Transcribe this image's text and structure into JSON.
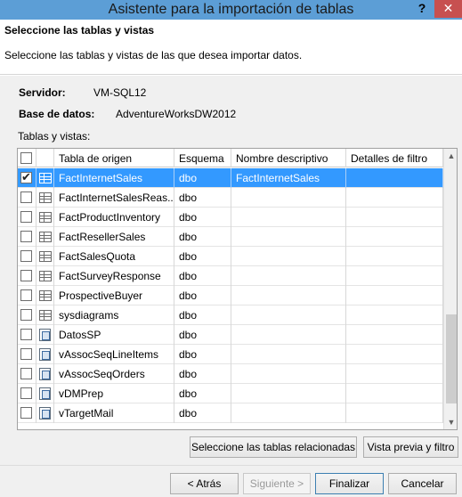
{
  "window": {
    "title": "Asistente para la importación de tablas",
    "help_label": "?",
    "close_label": "✕"
  },
  "header": {
    "heading": "Seleccione las tablas y vistas",
    "description": "Seleccione las tablas y vistas de las que desea importar datos."
  },
  "connection": {
    "server_label": "Servidor:",
    "server_value": "VM-SQL12",
    "database_label": "Base de datos:",
    "database_value": "AdventureWorksDW2012",
    "list_label": "Tablas y vistas:"
  },
  "grid": {
    "columns": [
      "Tabla de origen",
      "Esquema",
      "Nombre descriptivo",
      "Detalles de filtro"
    ],
    "rows": [
      {
        "name": "FactInternetSales",
        "schema": "dbo",
        "friendly": "FactInternetSales",
        "filter": "",
        "checked": true,
        "selected": true,
        "icon": "table-icon"
      },
      {
        "name": "FactInternetSalesReas...",
        "schema": "dbo",
        "friendly": "",
        "filter": "",
        "checked": false,
        "selected": false,
        "icon": "table-icon"
      },
      {
        "name": "FactProductInventory",
        "schema": "dbo",
        "friendly": "",
        "filter": "",
        "checked": false,
        "selected": false,
        "icon": "table-icon"
      },
      {
        "name": "FactResellerSales",
        "schema": "dbo",
        "friendly": "",
        "filter": "",
        "checked": false,
        "selected": false,
        "icon": "table-icon"
      },
      {
        "name": "FactSalesQuota",
        "schema": "dbo",
        "friendly": "",
        "filter": "",
        "checked": false,
        "selected": false,
        "icon": "table-icon"
      },
      {
        "name": "FactSurveyResponse",
        "schema": "dbo",
        "friendly": "",
        "filter": "",
        "checked": false,
        "selected": false,
        "icon": "table-icon"
      },
      {
        "name": "ProspectiveBuyer",
        "schema": "dbo",
        "friendly": "",
        "filter": "",
        "checked": false,
        "selected": false,
        "icon": "table-icon"
      },
      {
        "name": "sysdiagrams",
        "schema": "dbo",
        "friendly": "",
        "filter": "",
        "checked": false,
        "selected": false,
        "icon": "table-icon"
      },
      {
        "name": "DatosSP",
        "schema": "dbo",
        "friendly": "",
        "filter": "",
        "checked": false,
        "selected": false,
        "icon": "view-icon"
      },
      {
        "name": "vAssocSeqLineItems",
        "schema": "dbo",
        "friendly": "",
        "filter": "",
        "checked": false,
        "selected": false,
        "icon": "view-icon"
      },
      {
        "name": "vAssocSeqOrders",
        "schema": "dbo",
        "friendly": "",
        "filter": "",
        "checked": false,
        "selected": false,
        "icon": "view-icon"
      },
      {
        "name": "vDMPrep",
        "schema": "dbo",
        "friendly": "",
        "filter": "",
        "checked": false,
        "selected": false,
        "icon": "view-icon"
      },
      {
        "name": "vTargetMail",
        "schema": "dbo",
        "friendly": "",
        "filter": "",
        "checked": false,
        "selected": false,
        "icon": "view-icon"
      }
    ]
  },
  "buttons": {
    "related_tables": "Seleccione las tablas relacionadas",
    "preview_filter": "Vista previa y filtro",
    "back": "< Atrás",
    "next": "Siguiente >",
    "finish": "Finalizar",
    "cancel": "Cancelar"
  },
  "colors": {
    "title_bar": "#5c9ed6",
    "selection": "#3399ff",
    "close_button": "#c75050"
  }
}
